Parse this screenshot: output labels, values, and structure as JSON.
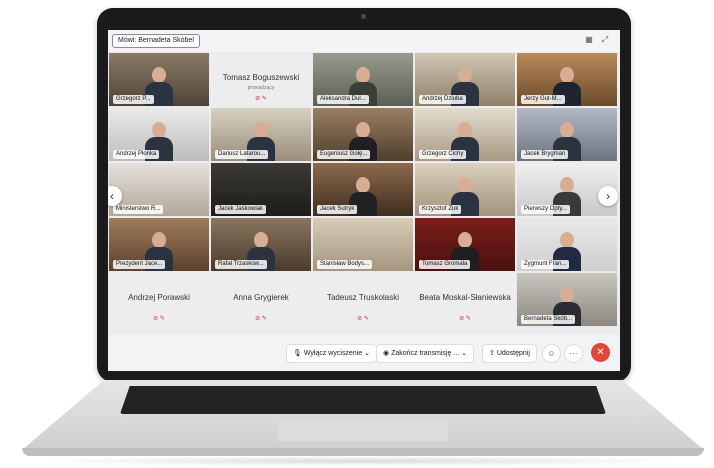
{
  "meeting": {
    "speaking_label": "Mówi: Bernadeta Skóbel",
    "top_icons": [
      "grid-icon",
      "pin-icon"
    ]
  },
  "participants": [
    {
      "name": "Grzegorz P...",
      "video": true
    },
    {
      "name": "Tomasz Boguszewski",
      "role": "prowadzący",
      "video": false
    },
    {
      "name": "Aleksandra Dul...",
      "video": true
    },
    {
      "name": "Andrzej Dziuba",
      "video": true
    },
    {
      "name": "Jerzy Gut-M...",
      "video": true
    },
    {
      "name": "Andrzej Płonka",
      "video": true
    },
    {
      "name": "Dariusz Latarou...",
      "video": true
    },
    {
      "name": "Eugeniusz Gołę...",
      "video": true
    },
    {
      "name": "Grzegorz Cichy",
      "video": true
    },
    {
      "name": "Jacek Brygman",
      "video": true
    },
    {
      "name": "Ministerstwo R...",
      "video": true
    },
    {
      "name": "Jacek Jaśkowiak",
      "video": true
    },
    {
      "name": "Jacek Sutryk",
      "video": true
    },
    {
      "name": "Krzysztof Żuk",
      "video": true
    },
    {
      "name": "Pierwszy Opty...",
      "video": true
    },
    {
      "name": "Prezydent Jace...",
      "video": true
    },
    {
      "name": "Rafał Trzaskow...",
      "video": true
    },
    {
      "name": "Stanisław Bodys...",
      "video": true
    },
    {
      "name": "Tomasz Gromala",
      "video": true
    },
    {
      "name": "Zygmunt Fran...",
      "video": true
    },
    {
      "name": "Andrzej Porawski",
      "video": false
    },
    {
      "name": "Anna Grygierek",
      "video": false
    },
    {
      "name": "Tadeusz Truskolaski",
      "video": false
    },
    {
      "name": "Beata Moskal-Słaniewska",
      "video": false
    },
    {
      "name": "Bernadeta Skób...",
      "video": true,
      "active": true
    }
  ],
  "toolbar": {
    "mute_label": "Wyłącz wyciszenie",
    "stop_stream_label": "Zakończ transmisję ...",
    "share_label": "Udostępnij",
    "more_label": "···",
    "hangup_icon": "hangup-icon"
  },
  "colors": {
    "accent": "#6ec3ee",
    "hangup": "#e0463a",
    "muted_icon": "#cc3333"
  }
}
